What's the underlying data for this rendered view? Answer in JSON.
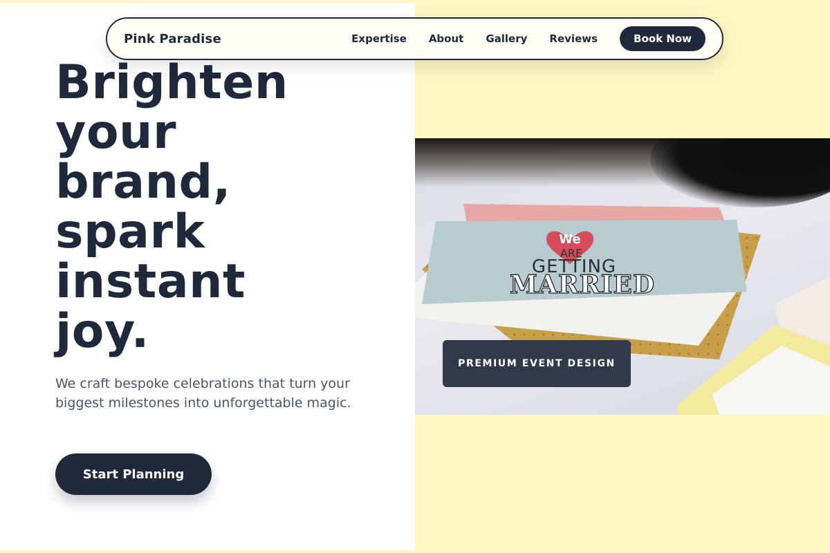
{
  "nav": {
    "brand": "Pink Paradise",
    "links": [
      "Expertise",
      "About",
      "Gallery",
      "Reviews"
    ],
    "cta": "Book Now"
  },
  "hero": {
    "title_lines": [
      "Brighten",
      "your",
      "brand,",
      "spark",
      "instant",
      "joy."
    ],
    "subtitle": "We craft bespoke celebrations that turn your biggest milestones into unforgettable magic.",
    "cta": "Start Planning"
  },
  "image": {
    "badge": "PREMIUM EVENT DESIGN",
    "card_text": {
      "we": "We",
      "are": "ARE",
      "getting": "GETTING",
      "married": "MARRIED"
    }
  },
  "colors": {
    "navy": "#1e293b",
    "cream": "#fef7c3",
    "slate_text": "#475569",
    "badge": "#303a4b"
  }
}
